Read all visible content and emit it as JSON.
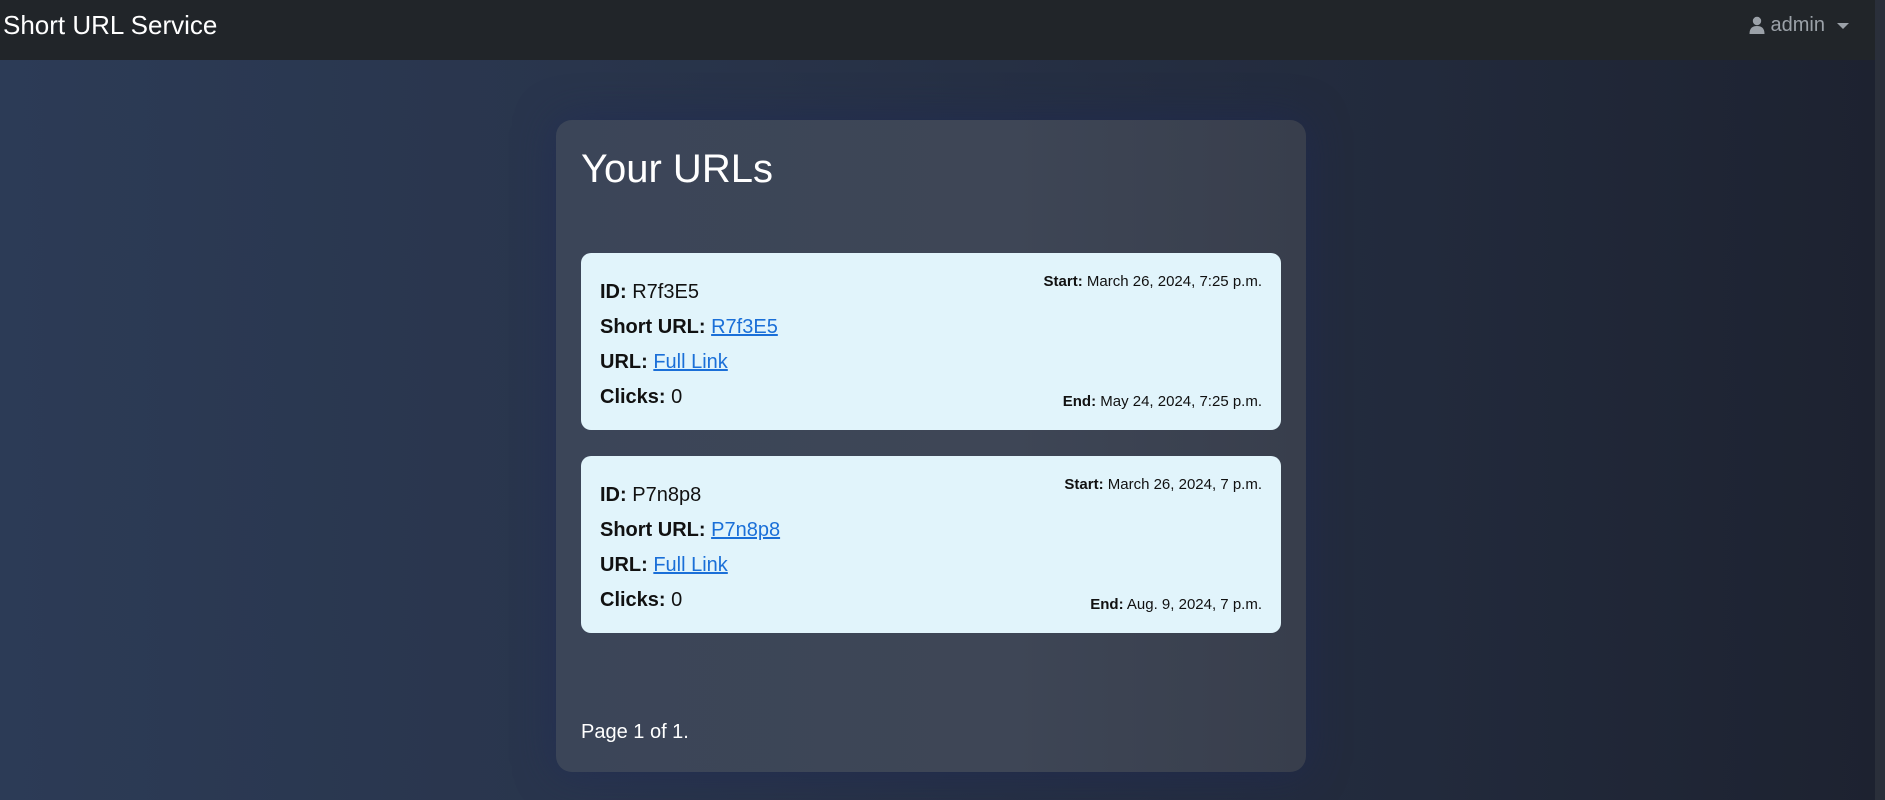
{
  "app": {
    "brand": "Short URL Service",
    "user_label": "admin"
  },
  "main": {
    "title": "Your URLs",
    "pagination": "Page 1 of 1.",
    "labels": {
      "id": "ID:",
      "short_url": "Short URL:",
      "url": "URL:",
      "clicks": "Clicks:",
      "start": "Start:",
      "end": "End:"
    },
    "urls": [
      {
        "id": "R7f3E5",
        "short_url": "R7f3E5",
        "url_link_text": "Full Link",
        "clicks": "0",
        "start": "March 26, 2024, 7:25 p.m.",
        "end": "May 24, 2024, 7:25 p.m."
      },
      {
        "id": "P7n8p8",
        "short_url": "P7n8p8",
        "url_link_text": "Full Link",
        "clicks": "0",
        "start": "March 26, 2024, 7 p.m.",
        "end": "Aug. 9, 2024, 7 p.m."
      }
    ]
  },
  "icons": {
    "user": "user-icon",
    "dropdown": "chevron-down-icon"
  },
  "colors": {
    "navbar": "#212529",
    "card_background": "#e1f4fb",
    "link": "#1a6fd8"
  }
}
